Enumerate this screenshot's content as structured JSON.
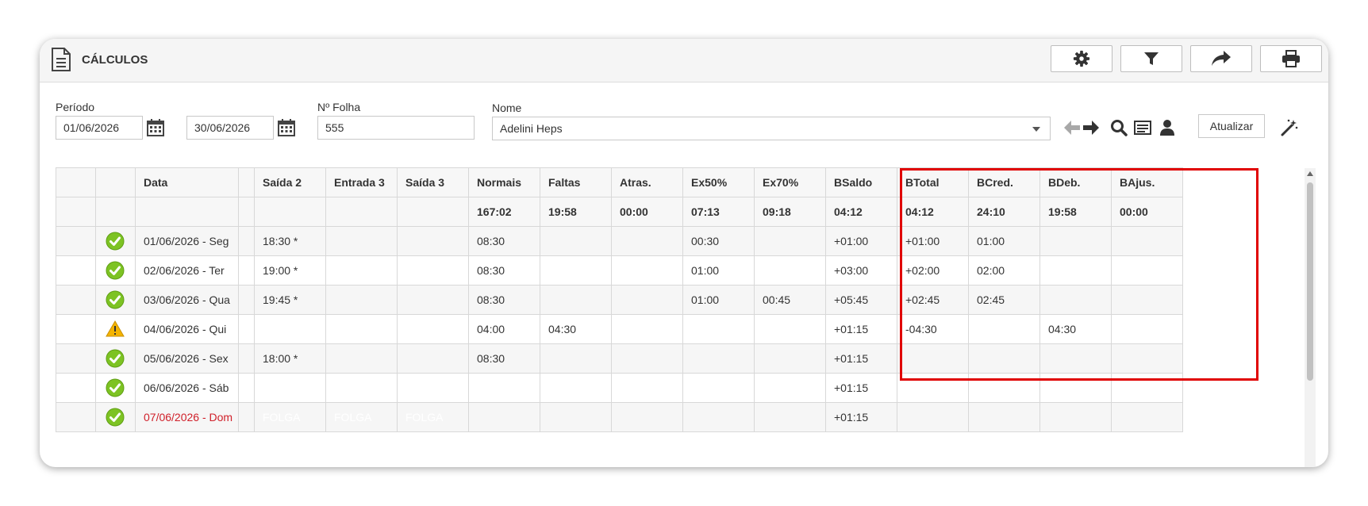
{
  "header": {
    "title": "CÁLCULOS"
  },
  "header_buttons": [
    {
      "icon": "gear-icon"
    },
    {
      "icon": "filter-icon"
    },
    {
      "icon": "share-icon"
    },
    {
      "icon": "print-icon"
    }
  ],
  "filters": {
    "periodo_label": "Período",
    "date_start": "01/06/2026",
    "date_end": "30/06/2026",
    "folha_label": "Nº Folha",
    "folha_value": "555",
    "nome_label": "Nome",
    "nome_value": "Adelini Heps",
    "atualizar_label": "Atualizar"
  },
  "table": {
    "columns": [
      "",
      "",
      "Data",
      "",
      "Saída 2",
      "Entrada 3",
      "Saída 3",
      "Normais",
      "Faltas",
      "Atras.",
      "Ex50%",
      "Ex70%",
      "BSaldo",
      "BTotal",
      "BCred.",
      "BDeb.",
      "BAjus."
    ],
    "totals": [
      "",
      "",
      "",
      "",
      "",
      "",
      "",
      "167:02",
      "19:58",
      "00:00",
      "07:13",
      "09:18",
      "04:12",
      "04:12",
      "24:10",
      "19:58",
      "00:00"
    ],
    "rows": [
      {
        "status": "ok",
        "cells": [
          "01/06/2026 - Seg",
          "",
          "18:30 *",
          "",
          "",
          "08:30",
          "",
          "",
          "00:30",
          "",
          "+01:00",
          "+01:00",
          "01:00",
          "",
          ""
        ]
      },
      {
        "status": "ok",
        "cells": [
          "02/06/2026 - Ter",
          "",
          "19:00 *",
          "",
          "",
          "08:30",
          "",
          "",
          "01:00",
          "",
          "+03:00",
          "+02:00",
          "02:00",
          "",
          ""
        ]
      },
      {
        "status": "ok",
        "cells": [
          "03/06/2026 - Qua",
          "",
          "19:45 *",
          "",
          "",
          "08:30",
          "",
          "",
          "01:00",
          "00:45",
          "+05:45",
          "+02:45",
          "02:45",
          "",
          ""
        ]
      },
      {
        "status": "warn",
        "cells": [
          "04/06/2026 - Qui",
          "",
          "",
          "",
          "",
          "04:00",
          "04:30",
          "",
          "",
          "",
          "+01:15",
          "-04:30",
          "",
          "04:30",
          ""
        ]
      },
      {
        "status": "ok",
        "cells": [
          "05/06/2026 - Sex",
          "",
          "18:00 *",
          "",
          "",
          "08:30",
          "",
          "",
          "",
          "",
          "+01:15",
          "",
          "",
          "",
          ""
        ]
      },
      {
        "status": "ok",
        "cells": [
          "06/06/2026 - Sáb",
          "",
          "",
          "",
          "",
          "",
          "",
          "",
          "",
          "",
          "+01:15",
          "",
          "",
          "",
          ""
        ]
      },
      {
        "status": "ok",
        "cells": [
          "07/06/2026 - Dom",
          "",
          "FOLGA",
          "FOLGA",
          "FOLGA",
          "",
          "",
          "",
          "",
          "",
          "+01:15",
          "",
          "",
          "",
          ""
        ]
      }
    ]
  },
  "colors": {
    "ok": "#7dc323",
    "warn": "#f4b400",
    "sunday": "#d0202a",
    "folga_bg": "#515459",
    "highlight": "#e00000"
  }
}
